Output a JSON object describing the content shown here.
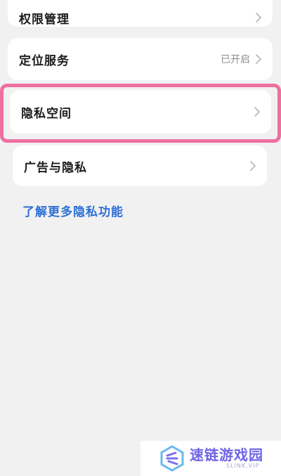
{
  "settings": {
    "permissions": {
      "label": "权限管理"
    },
    "location": {
      "label": "定位服务",
      "value": "已开启"
    },
    "private_space": {
      "label": "隐私空间"
    },
    "ads": {
      "label": "广告与隐私"
    }
  },
  "link": {
    "learn_more": "了解更多隐私功能"
  },
  "watermark": {
    "brand": "速链游戏园",
    "domain": "SLINK.VIP"
  },
  "colors": {
    "background": "#f1f1f1",
    "card": "#ffffff",
    "link": "#2e6fd6",
    "highlight": "#ef6fa0",
    "watermark": "#6f63e6"
  },
  "icons": [
    "chevron-right-icon",
    "watermark-logo-icon"
  ]
}
